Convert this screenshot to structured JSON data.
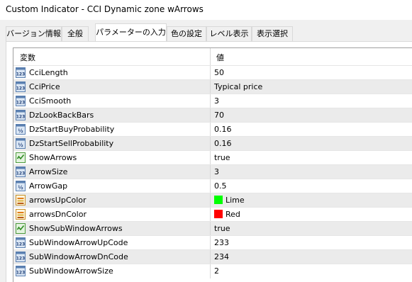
{
  "window": {
    "title": "Custom Indicator - CCI Dynamic zone wArrows"
  },
  "tabs": [
    {
      "label": "バージョン情報",
      "active": false
    },
    {
      "label": "全般",
      "active": false
    },
    {
      "label": "パラメーターの入力",
      "active": true
    },
    {
      "label": "色の設定",
      "active": false
    },
    {
      "label": "レベル表示",
      "active": false
    },
    {
      "label": "表示選択",
      "active": false
    }
  ],
  "table": {
    "headers": {
      "variable": "変数",
      "value": "値"
    },
    "rows": [
      {
        "icon": "int-icon",
        "name": "CciLength",
        "value": "50"
      },
      {
        "icon": "int-icon",
        "name": "CciPrice",
        "value": "Typical price"
      },
      {
        "icon": "int-icon",
        "name": "CciSmooth",
        "value": "3"
      },
      {
        "icon": "int-icon",
        "name": "DzLookBackBars",
        "value": "70"
      },
      {
        "icon": "double-icon",
        "name": "DzStartBuyProbability",
        "value": "0.16"
      },
      {
        "icon": "double-icon",
        "name": "DzStartSellProbability",
        "value": "0.16"
      },
      {
        "icon": "bool-icon",
        "name": "ShowArrows",
        "value": "true"
      },
      {
        "icon": "int-icon",
        "name": "ArrowSize",
        "value": "3"
      },
      {
        "icon": "double-icon",
        "name": "ArrowGap",
        "value": "0.5"
      },
      {
        "icon": "color-icon",
        "name": "arrowsUpColor",
        "value": "Lime",
        "swatch": "#00ff00"
      },
      {
        "icon": "color-icon",
        "name": "arrowsDnColor",
        "value": "Red",
        "swatch": "#ff0000"
      },
      {
        "icon": "bool-icon",
        "name": "ShowSubWindowArrows",
        "value": "true"
      },
      {
        "icon": "int-icon",
        "name": "SubWindowArrowUpCode",
        "value": "233"
      },
      {
        "icon": "int-icon",
        "name": "SubWindowArrowDnCode",
        "value": "234"
      },
      {
        "icon": "int-icon",
        "name": "SubWindowArrowSize",
        "value": "2"
      }
    ]
  }
}
